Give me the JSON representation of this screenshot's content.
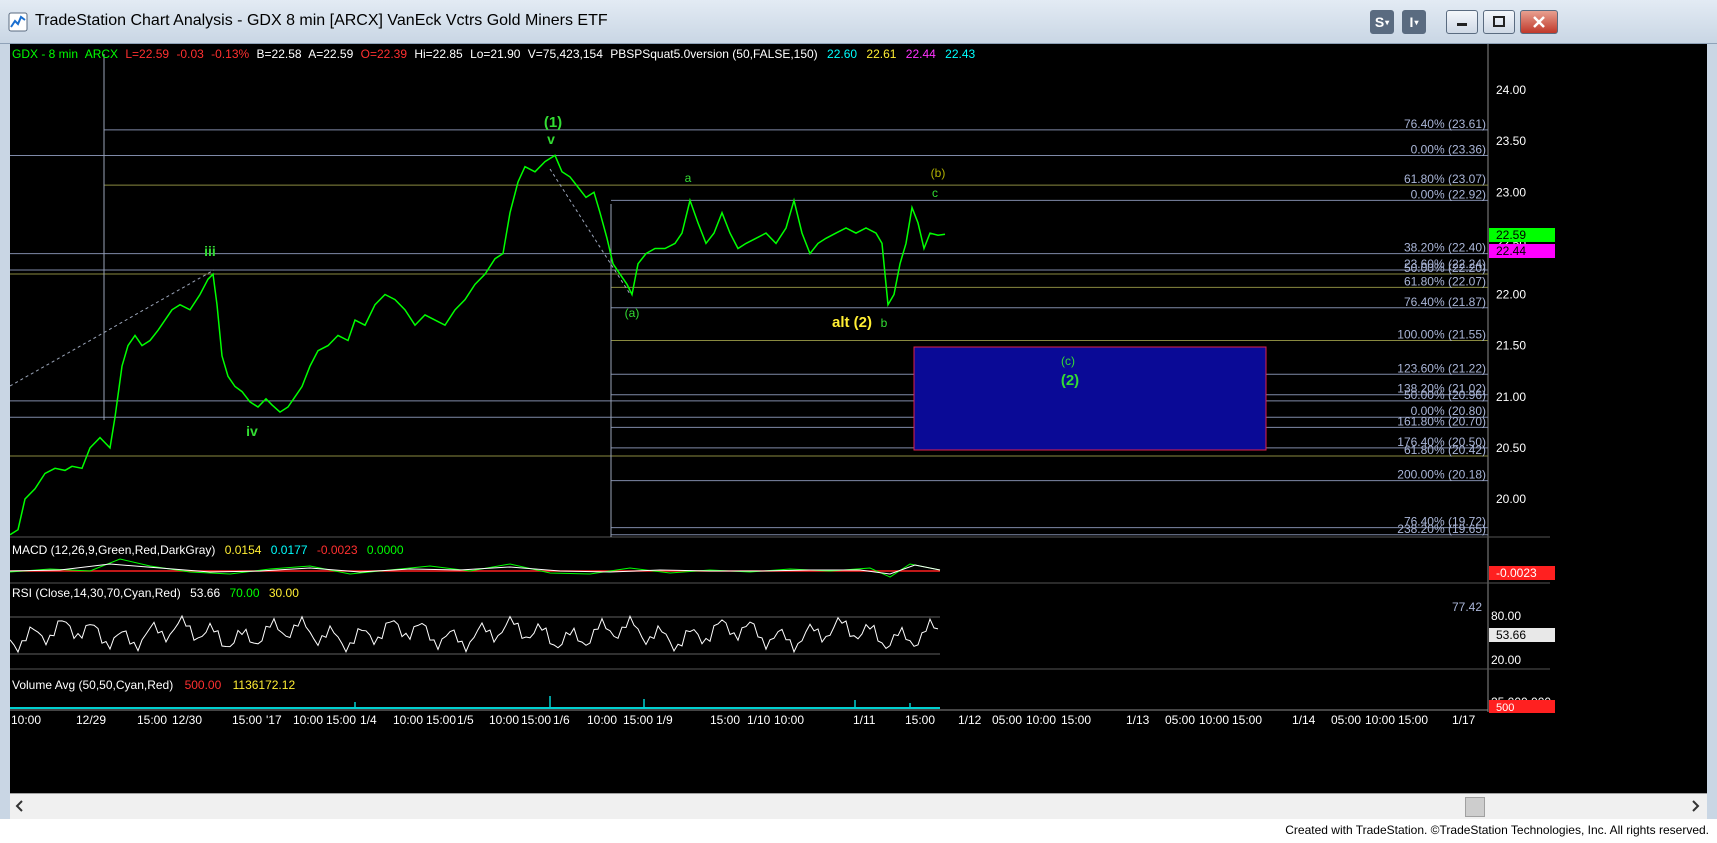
{
  "window": {
    "title": "TradeStation Chart Analysis - GDX 8 min [ARCX] VanEck Vctrs Gold Miners ETF",
    "btn_s": "S",
    "btn_i": "I",
    "footer": "Created with TradeStation. ©TradeStation Technologies, Inc. All rights reserved."
  },
  "colors": {
    "price": "#00ff00",
    "rsi": "#ffffff",
    "macd_line": "#00ff00",
    "macd_signal": "#ff3030",
    "target_box": "#0a0a96",
    "target_border": "#e0204a",
    "green_label": "#33dd33",
    "yellow_label": "#ffee33",
    "fib_label": "#aab6d8"
  },
  "header": {
    "symbol": "GDX - 8 min",
    "exchange": "ARCX",
    "last": "L=22.59",
    "chg": "-0.03",
    "pct": "-0.13%",
    "bid": "B=22.58",
    "ask": "A=22.59",
    "open": "O=22.39",
    "hi": "Hi=22.85",
    "lo": "Lo=21.90",
    "vol": "V=75,423,154",
    "indicator": "PBSPSquat5.0version (50,FALSE,150)",
    "v1": "22.60",
    "v2": "22.61",
    "v3": "22.44",
    "v4": "22.43"
  },
  "macd": {
    "label": "MACD (12,26,9,Green,Red,DarkGray)",
    "v1": "0.0154",
    "v2": "0.0177",
    "v3": "-0.0023",
    "v4": "0.0000",
    "axis_value": "-0.0023"
  },
  "rsi": {
    "label": "RSI (Close,14,30,70,Cyan,Red)",
    "value": "53.66",
    "ob": "70.00",
    "os": "30.00",
    "axis_80": "80.00",
    "axis_20": "20.00",
    "right_value": "77.42",
    "axis_value": "53.66"
  },
  "volume": {
    "label": "Volume Avg (50,50,Cyan,Red)",
    "v1": "500.00",
    "v2": "1136172.12",
    "axis_top": "25,000,000",
    "axis_value": "500"
  },
  "axis": {
    "price_ticks": [
      "24.00",
      "23.50",
      "23.00",
      "22.50",
      "22.00",
      "21.50",
      "21.00",
      "20.50",
      "20.00"
    ],
    "last_price": "22.59",
    "second_price": "22.44",
    "time_labels": [
      "10:00",
      "12/29",
      "15:00",
      "12/30",
      "15:00",
      "'17",
      "10:00",
      "15:00",
      "1/4",
      "10:00",
      "15:00",
      "1/5",
      "10:00",
      "15:00",
      "1/6",
      "10:00",
      "15:00",
      "1/9",
      "15:00",
      "1/10",
      "10:00",
      "1/11",
      "15:00",
      "1/12",
      "05:00",
      "10:00",
      "15:00",
      "1/13",
      "05:00",
      "10:00",
      "15:00",
      "1/14",
      "05:00",
      "10:00",
      "15:00",
      "1/17"
    ]
  },
  "fib_labels": [
    "76.40% (23.61)",
    "0.00% (23.36)",
    "61.80% (23.07)",
    "0.00% (22.92)",
    "38.20% (22.40)",
    "23.60% (22.24)",
    "50.00% (22.20)",
    "61.80% (22.07)",
    "76.40% (21.87)",
    "100.00% (21.55)",
    "123.60% (21.22)",
    "138.20% (21.02)",
    "50.00% (20.96)",
    "0.00% (20.80)",
    "161.80% (20.70)",
    "176.40% (20.50)",
    "61.80% (20.42)",
    "200.00% (20.18)",
    "76.40% (19.72)",
    "238.20% (19.65)"
  ],
  "wave_labels": {
    "iii": "iii",
    "iv": "iv",
    "w1": "(1)",
    "v": "v",
    "a": "a",
    "wa": "(a)",
    "wb": "(b)",
    "c": "c",
    "b": "b",
    "alt2": "alt (2)",
    "wc": "(c)",
    "w2": "(2)"
  },
  "chart_data": {
    "type": "line",
    "title": "GDX - 8 min",
    "ylim": [
      19.6,
      24.3
    ],
    "price_path": [
      [
        0,
        19.65
      ],
      [
        8,
        19.7
      ],
      [
        15,
        20.0
      ],
      [
        25,
        20.1
      ],
      [
        35,
        20.25
      ],
      [
        45,
        20.3
      ],
      [
        55,
        20.28
      ],
      [
        62,
        20.32
      ],
      [
        72,
        20.3
      ],
      [
        80,
        20.5
      ],
      [
        90,
        20.6
      ],
      [
        100,
        20.5
      ],
      [
        105,
        20.8
      ],
      [
        112,
        21.3
      ],
      [
        118,
        21.5
      ],
      [
        125,
        21.6
      ],
      [
        132,
        21.5
      ],
      [
        140,
        21.55
      ],
      [
        148,
        21.65
      ],
      [
        155,
        21.75
      ],
      [
        162,
        21.85
      ],
      [
        170,
        21.9
      ],
      [
        180,
        21.85
      ],
      [
        190,
        22.0
      ],
      [
        198,
        22.15
      ],
      [
        203,
        22.2
      ],
      [
        207,
        21.9
      ],
      [
        212,
        21.4
      ],
      [
        218,
        21.2
      ],
      [
        225,
        21.1
      ],
      [
        232,
        21.05
      ],
      [
        240,
        20.95
      ],
      [
        248,
        20.9
      ],
      [
        256,
        20.98
      ],
      [
        262,
        20.92
      ],
      [
        270,
        20.85
      ],
      [
        278,
        20.9
      ],
      [
        285,
        21.0
      ],
      [
        292,
        21.1
      ],
      [
        300,
        21.3
      ],
      [
        308,
        21.45
      ],
      [
        318,
        21.5
      ],
      [
        328,
        21.6
      ],
      [
        338,
        21.55
      ],
      [
        345,
        21.75
      ],
      [
        355,
        21.7
      ],
      [
        365,
        21.9
      ],
      [
        375,
        22.0
      ],
      [
        385,
        21.95
      ],
      [
        395,
        21.85
      ],
      [
        405,
        21.7
      ],
      [
        415,
        21.8
      ],
      [
        425,
        21.75
      ],
      [
        435,
        21.7
      ],
      [
        445,
        21.85
      ],
      [
        455,
        21.95
      ],
      [
        465,
        22.1
      ],
      [
        475,
        22.2
      ],
      [
        485,
        22.35
      ],
      [
        493,
        22.4
      ],
      [
        500,
        22.8
      ],
      [
        508,
        23.1
      ],
      [
        515,
        23.25
      ],
      [
        525,
        23.2
      ],
      [
        535,
        23.3
      ],
      [
        545,
        23.36
      ],
      [
        552,
        23.2
      ],
      [
        560,
        23.15
      ],
      [
        568,
        23.05
      ],
      [
        576,
        22.95
      ],
      [
        584,
        23.0
      ],
      [
        590,
        22.8
      ],
      [
        597,
        22.55
      ],
      [
        603,
        22.3
      ],
      [
        610,
        22.2
      ],
      [
        617,
        22.1
      ],
      [
        622,
        22.0
      ],
      [
        628,
        22.3
      ],
      [
        636,
        22.4
      ],
      [
        645,
        22.45
      ],
      [
        655,
        22.45
      ],
      [
        665,
        22.5
      ],
      [
        672,
        22.6
      ],
      [
        680,
        22.92
      ],
      [
        688,
        22.7
      ],
      [
        696,
        22.5
      ],
      [
        704,
        22.6
      ],
      [
        712,
        22.8
      ],
      [
        720,
        22.6
      ],
      [
        728,
        22.45
      ],
      [
        736,
        22.5
      ],
      [
        746,
        22.55
      ],
      [
        756,
        22.6
      ],
      [
        766,
        22.5
      ],
      [
        776,
        22.65
      ],
      [
        784,
        22.92
      ],
      [
        792,
        22.6
      ],
      [
        800,
        22.4
      ],
      [
        808,
        22.5
      ],
      [
        816,
        22.55
      ],
      [
        826,
        22.6
      ],
      [
        836,
        22.65
      ],
      [
        846,
        22.6
      ],
      [
        856,
        22.65
      ],
      [
        866,
        22.6
      ],
      [
        872,
        22.5
      ],
      [
        878,
        21.9
      ],
      [
        884,
        22.0
      ],
      [
        890,
        22.3
      ],
      [
        896,
        22.5
      ],
      [
        902,
        22.85
      ],
      [
        908,
        22.7
      ],
      [
        914,
        22.45
      ],
      [
        920,
        22.6
      ],
      [
        928,
        22.58
      ],
      [
        935,
        22.59
      ]
    ],
    "fib_levels": [
      23.61,
      23.36,
      23.07,
      22.92,
      22.4,
      22.24,
      22.2,
      22.07,
      21.87,
      21.55,
      21.22,
      21.02,
      20.96,
      20.8,
      20.7,
      20.5,
      20.42,
      20.18,
      19.72,
      19.65
    ],
    "target_box": {
      "x_start": "1/11 15:00",
      "x_end": "1/14",
      "y_top": 21.48,
      "y_bottom": 20.5
    }
  }
}
